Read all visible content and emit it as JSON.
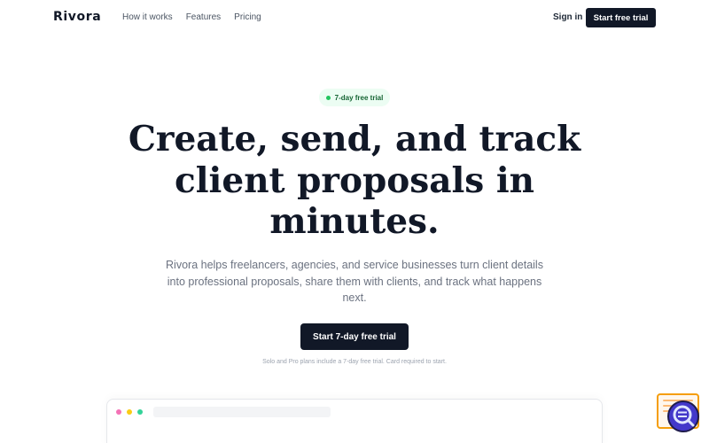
{
  "nav": {
    "logo": "Rivora",
    "links": [
      "How it works",
      "Features",
      "Pricing"
    ],
    "sign_in": "Sign in",
    "cta": "Start free trial"
  },
  "hero": {
    "badge": "7-day free trial",
    "headline_lines": [
      "Create, send, and track",
      "client proposals in",
      "minutes."
    ],
    "subtitle_lines": [
      "Rivora helps freelancers, agencies, and service businesses turn client details",
      "into professional proposals, share them with clients, and track what happens",
      "next."
    ],
    "cta": "Start 7-day free trial",
    "note": "Solo and Pro plans include a 7-day free trial. Card required to start."
  },
  "colors": {
    "primary": "#111827",
    "badge_bg": "#ecfdf3",
    "badge_dot": "#22c55e",
    "muted_text": "#6b7280"
  },
  "icons": {
    "badge_dot": "status-dot-icon",
    "widget": "search-chat-widget-icon"
  }
}
